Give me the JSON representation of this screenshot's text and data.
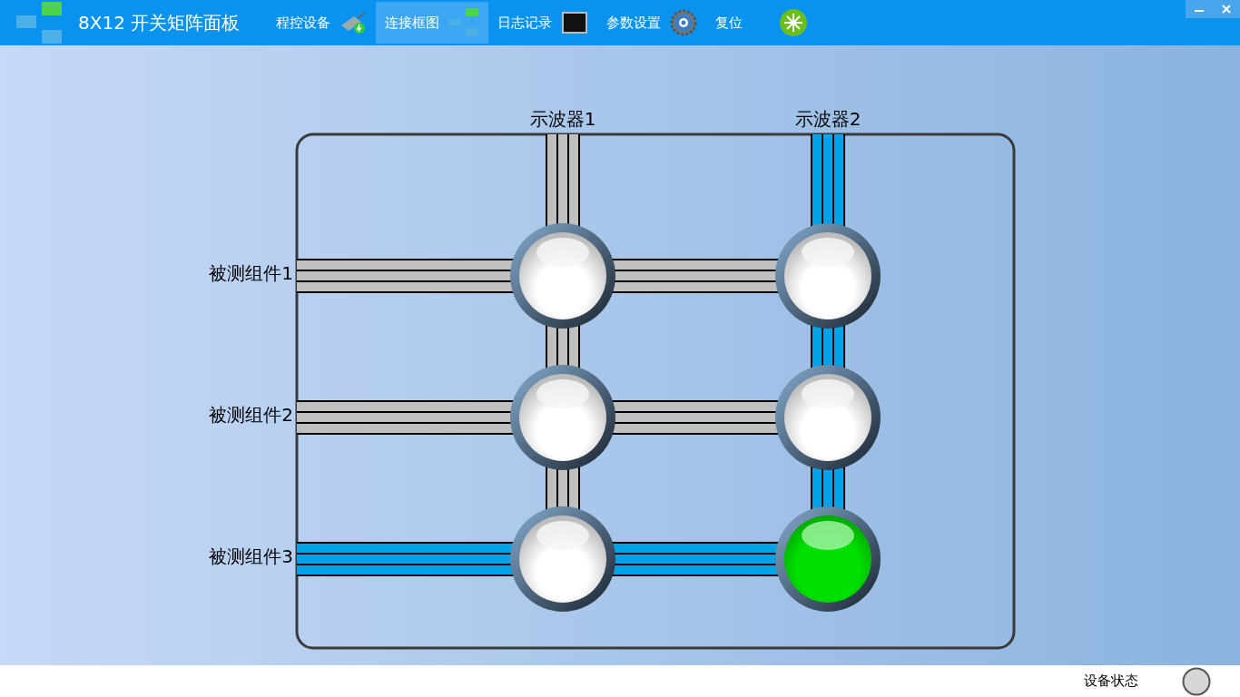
{
  "app": {
    "title": "8X12 开关矩阵面板"
  },
  "nav": [
    {
      "label": "程控设备",
      "kind": "device",
      "selected": false
    },
    {
      "label": "连接框图",
      "kind": "diagram",
      "selected": true
    },
    {
      "label": "日志记录",
      "kind": "log",
      "selected": false
    },
    {
      "label": "参数设置",
      "kind": "settings",
      "selected": false
    },
    {
      "label": "复位",
      "kind": "reset",
      "selected": false
    }
  ],
  "matrix": {
    "outputs": [
      {
        "label": "示波器1",
        "active": false
      },
      {
        "label": "示波器2",
        "active": true
      }
    ],
    "inputs": [
      {
        "label": "被测组件1",
        "active": false,
        "switches": [
          {
            "on": false
          },
          {
            "on": false
          }
        ]
      },
      {
        "label": "被测组件2",
        "active": false,
        "switches": [
          {
            "on": false
          },
          {
            "on": false
          }
        ]
      },
      {
        "label": "被测组件3",
        "active": true,
        "switches": [
          {
            "on": false
          },
          {
            "on": true
          }
        ]
      }
    ]
  },
  "status_bar": {
    "label": "设备状态",
    "connected": false
  }
}
